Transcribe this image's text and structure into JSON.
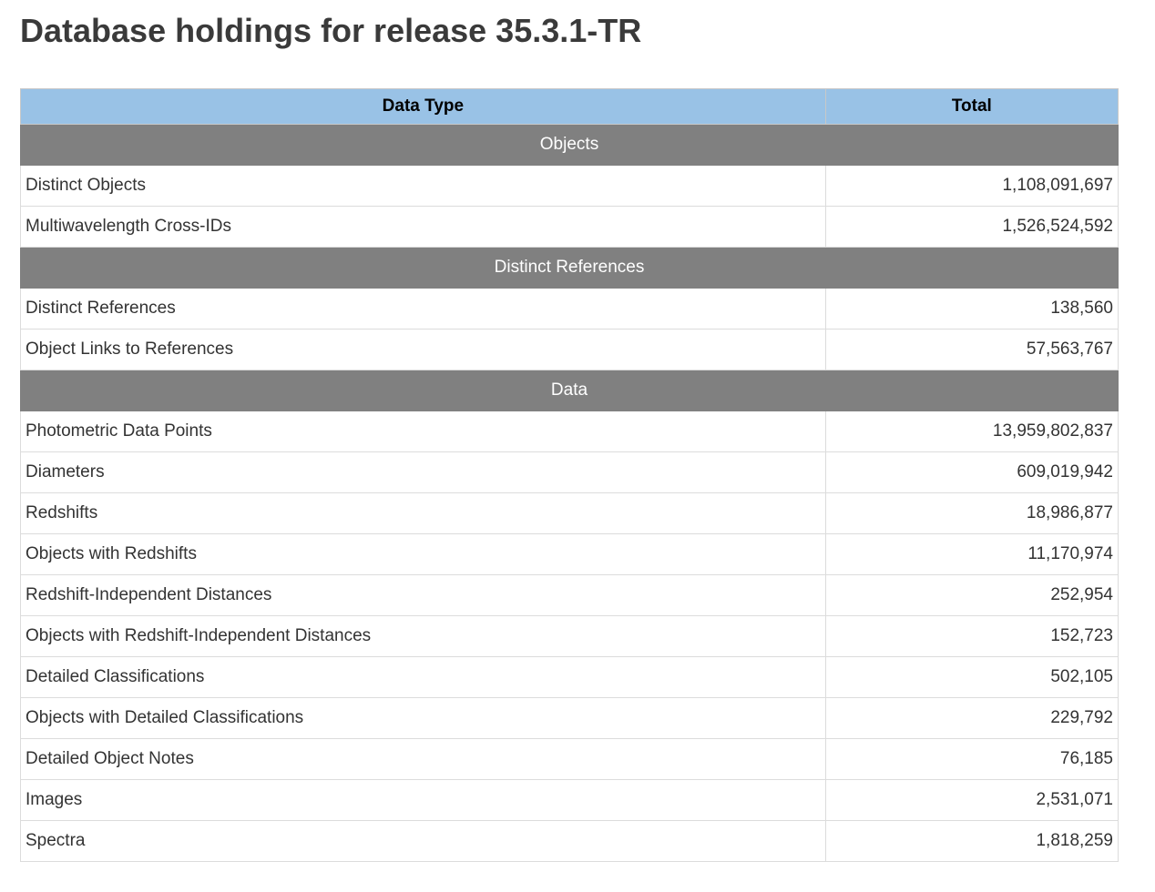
{
  "page": {
    "title": "Database holdings for release 35.3.1-TR"
  },
  "table": {
    "headers": {
      "type": "Data Type",
      "total": "Total"
    },
    "sections": [
      {
        "title": "Objects",
        "rows": [
          {
            "label": "Distinct Objects",
            "value": "1,108,091,697"
          },
          {
            "label": "Multiwavelength Cross-IDs",
            "value": "1,526,524,592"
          }
        ]
      },
      {
        "title": "Distinct References",
        "rows": [
          {
            "label": "Distinct References",
            "value": "138,560"
          },
          {
            "label": "Object Links to References",
            "value": "57,563,767"
          }
        ]
      },
      {
        "title": "Data",
        "rows": [
          {
            "label": "Photometric Data Points",
            "value": "13,959,802,837"
          },
          {
            "label": "Diameters",
            "value": "609,019,942"
          },
          {
            "label": "Redshifts",
            "value": "18,986,877"
          },
          {
            "label": "Objects with Redshifts",
            "value": "11,170,974"
          },
          {
            "label": "Redshift-Independent Distances",
            "value": "252,954"
          },
          {
            "label": "Objects with Redshift-Independent Distances",
            "value": "152,723"
          },
          {
            "label": "Detailed Classifications",
            "value": "502,105"
          },
          {
            "label": "Objects with Detailed Classifications",
            "value": "229,792"
          },
          {
            "label": "Detailed Object Notes",
            "value": "76,185"
          },
          {
            "label": "Images",
            "value": "2,531,071"
          },
          {
            "label": "Spectra",
            "value": "1,818,259"
          }
        ]
      }
    ]
  },
  "colors": {
    "header_background": "#99c2e6",
    "section_background": "#808080",
    "text": "#333333"
  }
}
